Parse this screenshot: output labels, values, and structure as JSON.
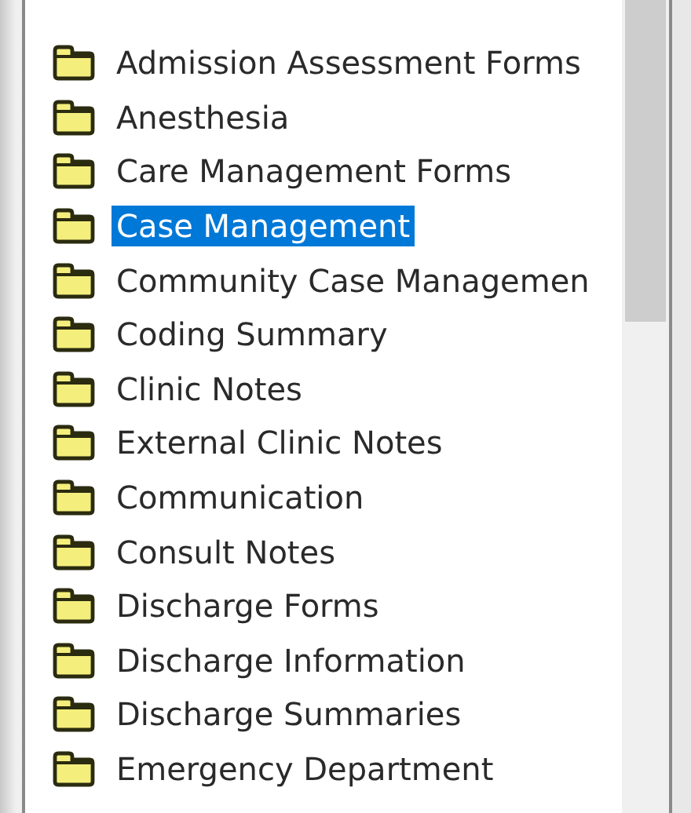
{
  "folders": [
    {
      "label": "Admission Assessment Forms",
      "selected": false
    },
    {
      "label": "Anesthesia",
      "selected": false
    },
    {
      "label": "Care Management Forms",
      "selected": false
    },
    {
      "label": "Case Management",
      "selected": true
    },
    {
      "label": "Community Case Managemen",
      "selected": false
    },
    {
      "label": "Coding Summary",
      "selected": false
    },
    {
      "label": "Clinic Notes",
      "selected": false
    },
    {
      "label": "External Clinic Notes",
      "selected": false
    },
    {
      "label": "Communication",
      "selected": false
    },
    {
      "label": "Consult Notes",
      "selected": false
    },
    {
      "label": "Discharge Forms",
      "selected": false
    },
    {
      "label": "Discharge Information",
      "selected": false
    },
    {
      "label": "Discharge Summaries",
      "selected": false
    },
    {
      "label": "Emergency Department",
      "selected": false
    }
  ]
}
